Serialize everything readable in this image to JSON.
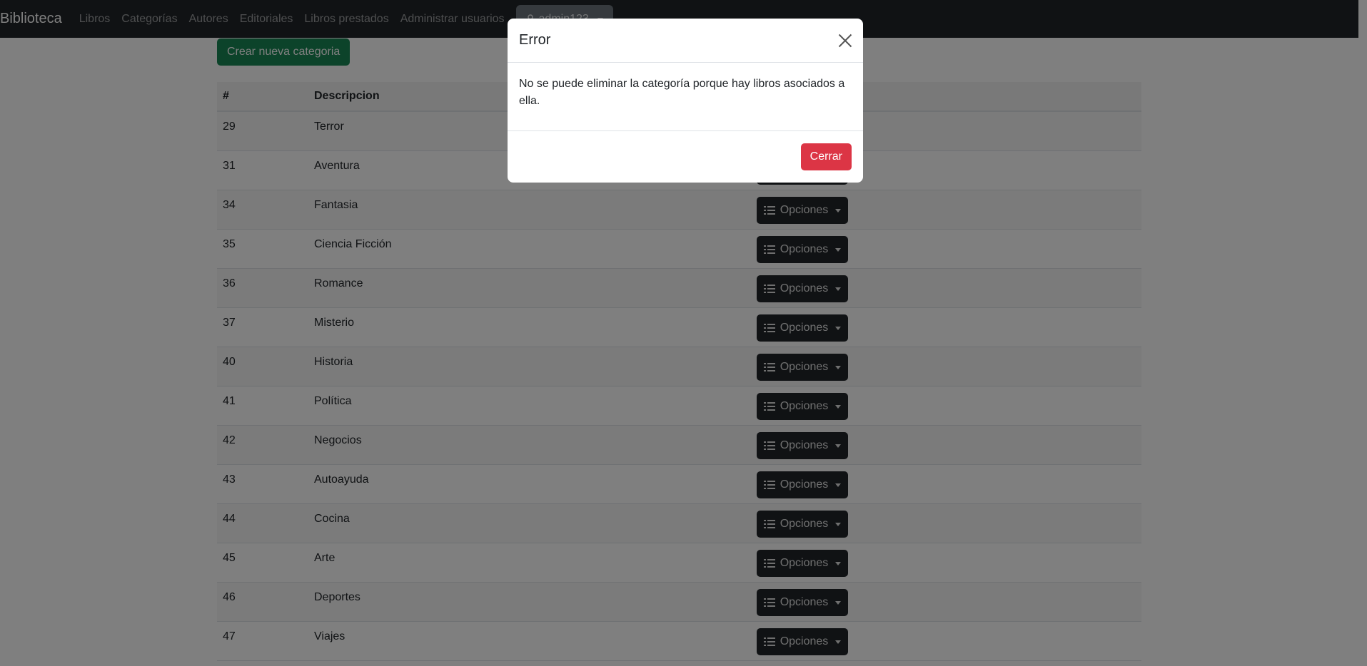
{
  "navbar": {
    "brand": "Biblioteca",
    "links": [
      "Libros",
      "Categorías",
      "Autores",
      "Editoriales",
      "Libros prestados",
      "Administrar usuarios"
    ],
    "user": "admin123"
  },
  "main": {
    "create_button": "Crear nueva categoria",
    "table": {
      "headers": [
        "#",
        "Descripcion",
        ""
      ],
      "rows": [
        {
          "id": "29",
          "desc": "Terror"
        },
        {
          "id": "31",
          "desc": "Aventura"
        },
        {
          "id": "34",
          "desc": "Fantasia"
        },
        {
          "id": "35",
          "desc": "Ciencia Ficción"
        },
        {
          "id": "36",
          "desc": "Romance"
        },
        {
          "id": "37",
          "desc": "Misterio"
        },
        {
          "id": "40",
          "desc": "Historia"
        },
        {
          "id": "41",
          "desc": "Política"
        },
        {
          "id": "42",
          "desc": "Negocios"
        },
        {
          "id": "43",
          "desc": "Autoayuda"
        },
        {
          "id": "44",
          "desc": "Cocina"
        },
        {
          "id": "45",
          "desc": "Arte"
        },
        {
          "id": "46",
          "desc": "Deportes"
        },
        {
          "id": "47",
          "desc": "Viajes"
        }
      ],
      "options_label": "Opciones"
    }
  },
  "modal": {
    "title": "Error",
    "message": "No se puede eliminar la categoría porque hay libros asociados a ella.",
    "close_button": "Cerrar"
  },
  "colors": {
    "navbar": "#212529",
    "create_button": "#198754",
    "options_button": "#212529",
    "close_button": "#dc3545"
  }
}
